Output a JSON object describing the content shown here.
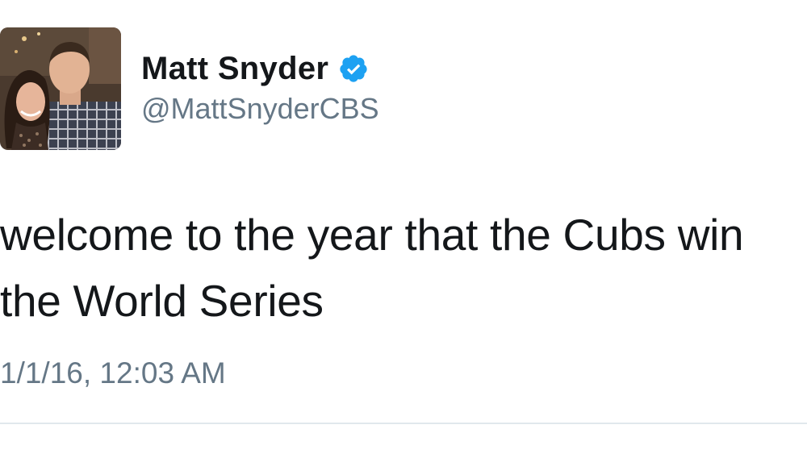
{
  "author": {
    "display_name": "Matt Snyder",
    "handle": "@MattSnyderCBS",
    "verified": true,
    "avatar_icon": "profile-photo"
  },
  "tweet": {
    "text": "welcome to the year that the Cubs win the World Series",
    "timestamp": "1/1/16, 12:03 AM"
  },
  "colors": {
    "text_primary": "#14171a",
    "text_secondary": "#657786",
    "verified_blue": "#1da1f2",
    "divider": "#e1e8ed"
  }
}
